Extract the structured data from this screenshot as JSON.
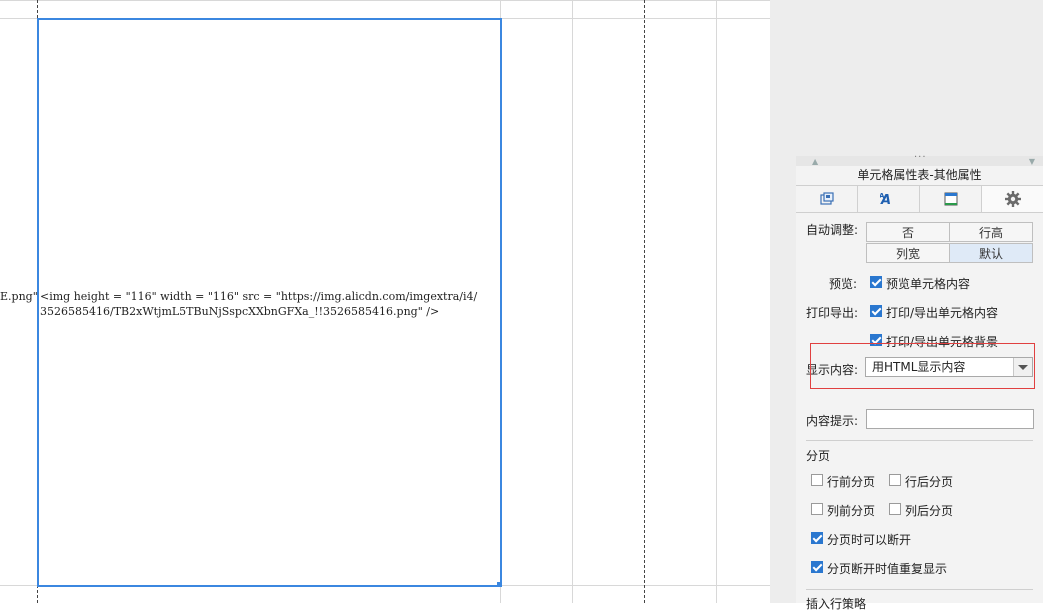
{
  "sheet": {
    "cell_left_text": "E.png\"",
    "cell_text_line1": "<img height = \"116\" width = \"116\" src = \"https://img.alicdn.com/imgextra/i4/",
    "cell_text_line2": "3526585416/TB2xWtjmL5TBuNjSspcXXbnGFXa_!!3526585416.png\" />"
  },
  "panel": {
    "title": "单元格属性表-其他属性",
    "tabs": [
      {
        "icon": "style-icon",
        "label": ""
      },
      {
        "icon": "font-icon",
        "label": ""
      },
      {
        "icon": "border-icon",
        "label": ""
      },
      {
        "icon": "gear-icon",
        "label": ""
      }
    ],
    "auto_adjust": {
      "label": "自动调整:",
      "options": [
        "否",
        "行高",
        "列宽",
        "默认"
      ],
      "selected": "默认"
    },
    "preview": {
      "label": "预览:",
      "checkbox": "预览单元格内容",
      "checked": true
    },
    "print_export": {
      "label": "打印导出:",
      "content": "打印/导出单元格内容",
      "background": "打印/导出单元格背景",
      "content_checked": true,
      "background_checked": true
    },
    "display_content": {
      "label": "显示内容:",
      "value": "用HTML显示内容"
    },
    "content_hint": {
      "label": "内容提示:",
      "value": ""
    },
    "pagination": {
      "heading": "分页",
      "row_before": "行前分页",
      "row_after": "行后分页",
      "col_before": "列前分页",
      "col_after": "列后分页",
      "break_allowed": "分页时可以断开",
      "repeat_on_break": "分页断开时值重复显示"
    },
    "cut_off_heading": "插入行策略"
  },
  "colors": {
    "selection": "#3b87e0",
    "highlight": "#e04040",
    "checkbox": "#2a77cf"
  }
}
